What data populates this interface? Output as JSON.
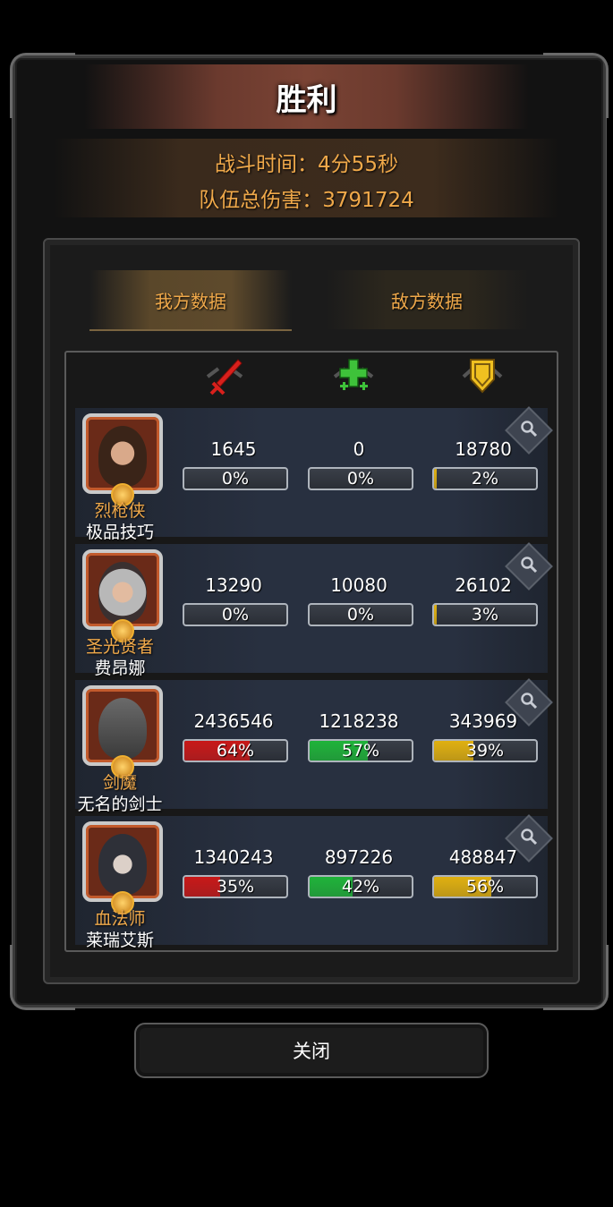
{
  "header": {
    "title": "胜利",
    "battle_time": "战斗时间：4分55秒",
    "team_damage": "队伍总伤害：3791724"
  },
  "tabs": [
    {
      "label": "我方数据",
      "active": true
    },
    {
      "label": "敌方数据",
      "active": false
    }
  ],
  "columns": [
    {
      "icon": "red-sword-icon",
      "color": "#d8201c"
    },
    {
      "icon": "green-heal-cross-icon",
      "color": "#3ec23a"
    },
    {
      "icon": "yellow-shield-icon",
      "color": "#f0c020"
    }
  ],
  "bar_colors": [
    "#c81818",
    "#1fb33a",
    "#e0b010"
  ],
  "heroes": [
    {
      "role": "烈枪侠",
      "name": "极品技巧",
      "damage": "1645",
      "damage_pct": "0%",
      "damage_frac": 0,
      "heal": "0",
      "heal_pct": "0%",
      "heal_frac": 0,
      "tank": "18780",
      "tank_pct": "2%",
      "tank_frac": 0.02
    },
    {
      "role": "圣光贤者",
      "name": "费昂娜",
      "damage": "13290",
      "damage_pct": "0%",
      "damage_frac": 0,
      "heal": "10080",
      "heal_pct": "0%",
      "heal_frac": 0,
      "tank": "26102",
      "tank_pct": "3%",
      "tank_frac": 0.03
    },
    {
      "role": "剑魔",
      "name": "无名的剑士",
      "damage": "2436546",
      "damage_pct": "64%",
      "damage_frac": 0.64,
      "heal": "1218238",
      "heal_pct": "57%",
      "heal_frac": 0.57,
      "tank": "343969",
      "tank_pct": "39%",
      "tank_frac": 0.39
    },
    {
      "role": "血法师",
      "name": "莱瑞艾斯",
      "damage": "1340243",
      "damage_pct": "35%",
      "damage_frac": 0.35,
      "heal": "897226",
      "heal_pct": "42%",
      "heal_frac": 0.42,
      "tank": "488847",
      "tank_pct": "56%",
      "tank_frac": 0.56
    }
  ],
  "close_label": "关闭"
}
